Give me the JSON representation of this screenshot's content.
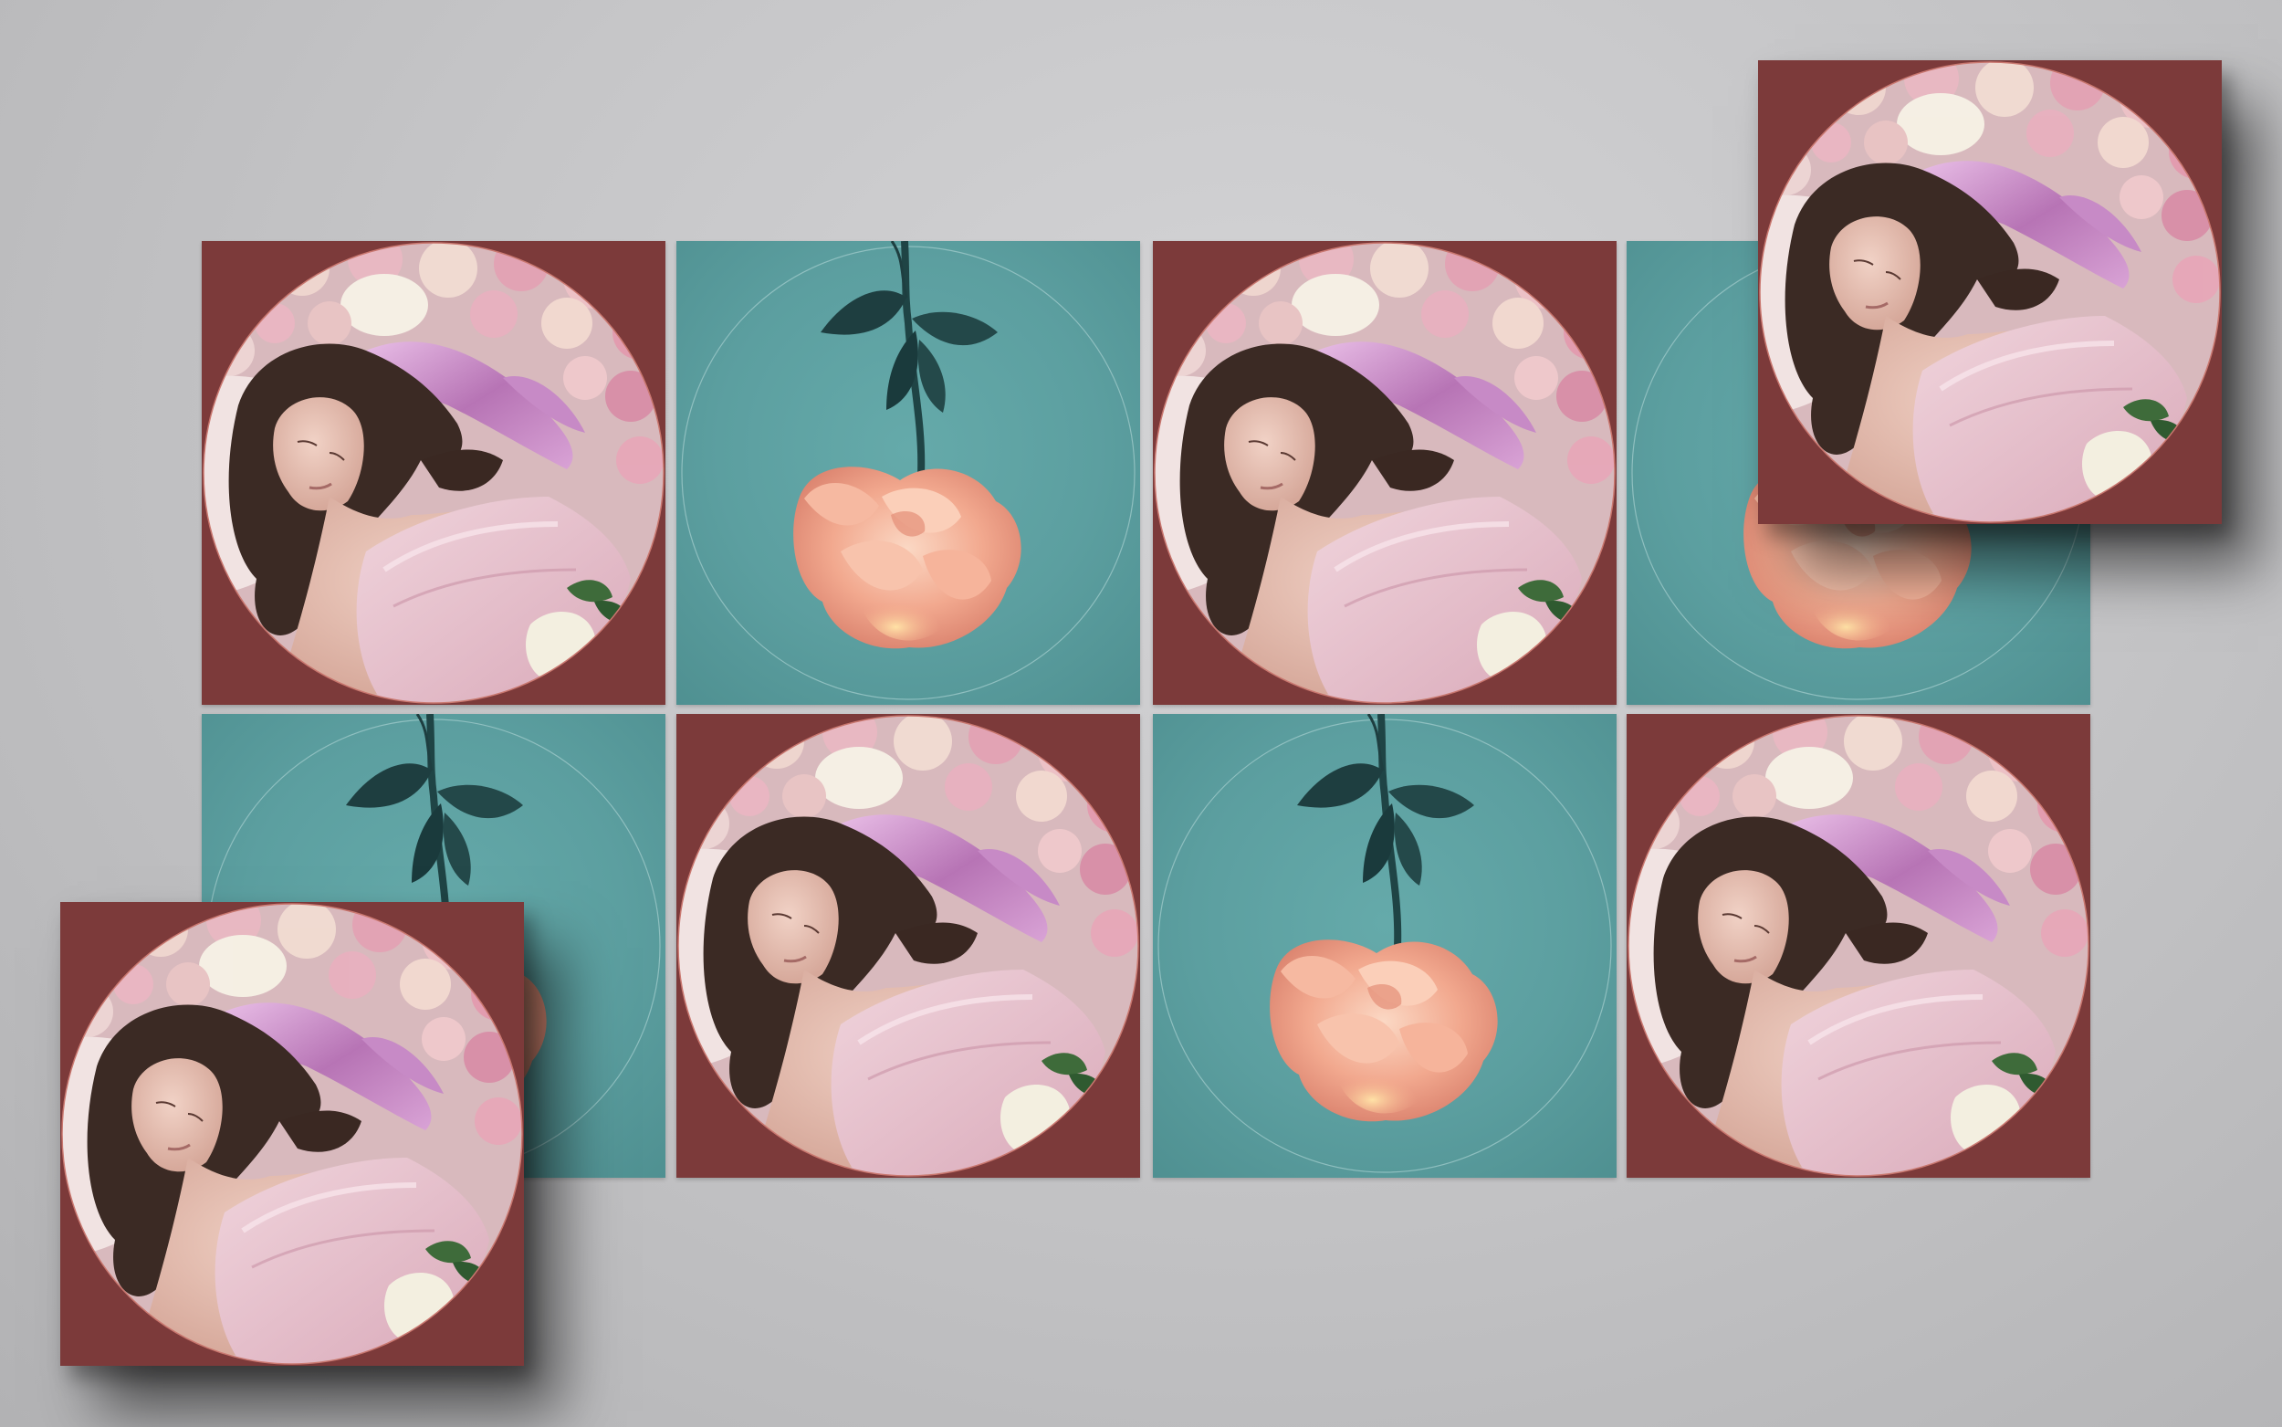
{
  "scene": {
    "description_colors": {
      "background": "#c8c8ca",
      "teal_cover": "#5e9fa0",
      "maroon_cover": "#7c3a3a",
      "rose_peach": "#f2a98f",
      "leaf_dark": "#1f3f40"
    }
  },
  "tiles": [
    {
      "kind": "portrait",
      "icon": "sleeping-woman-portrait"
    },
    {
      "kind": "rose",
      "icon": "hanging-rose"
    },
    {
      "kind": "portrait",
      "icon": "sleeping-woman-portrait"
    },
    {
      "kind": "rose",
      "icon": "hanging-rose"
    },
    {
      "kind": "rose",
      "icon": "hanging-rose"
    },
    {
      "kind": "portrait",
      "icon": "sleeping-woman-portrait"
    },
    {
      "kind": "rose",
      "icon": "hanging-rose"
    },
    {
      "kind": "portrait",
      "icon": "sleeping-woman-portrait"
    },
    {
      "kind": "portrait",
      "icon": "sleeping-woman-portrait",
      "lifted": true
    },
    {
      "kind": "portrait",
      "icon": "sleeping-woman-portrait",
      "lifted": true
    }
  ]
}
